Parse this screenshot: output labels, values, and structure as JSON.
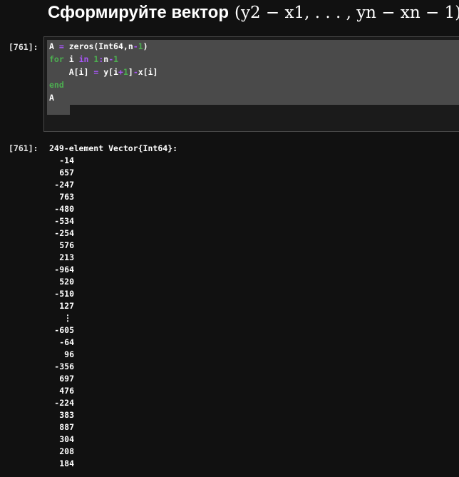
{
  "heading": {
    "text": "Сформируйте вектор",
    "math": "(y2 − x1, . . . , yn − xn − 1)"
  },
  "input_cell": {
    "prompt": "[761]:",
    "code": {
      "line1": {
        "a": "A",
        "eq": "=",
        "call": "zeros(Int64,n",
        "minus": "-",
        "one": "1",
        "close": ")"
      },
      "line2": {
        "for": "for",
        "i": "i",
        "in": "in",
        "start": "1",
        "colon": ":",
        "n": "n",
        "minus": "-",
        "one": "1"
      },
      "line3": {
        "lhs": "A[i]",
        "eq": "=",
        "y": "y[i",
        "plus": "+",
        "one": "1",
        "close": "]",
        "minus": "-",
        "x": "x[i]"
      },
      "line4": {
        "end": "end"
      },
      "line5": {
        "a": "A"
      }
    }
  },
  "output_cell": {
    "prompt": "[761]:",
    "header": "249-element Vector{Int64}:",
    "head_values": [
      "-14",
      "657",
      "-247",
      "763",
      "-480",
      "-534",
      "-254",
      "576",
      "213",
      "-964",
      "520",
      "-510",
      "127"
    ],
    "ellipsis": "⋮",
    "tail_values": [
      "-605",
      "-64",
      "96",
      "-356",
      "697",
      "476",
      "-224",
      "383",
      "887",
      "304",
      "208",
      "184"
    ]
  }
}
